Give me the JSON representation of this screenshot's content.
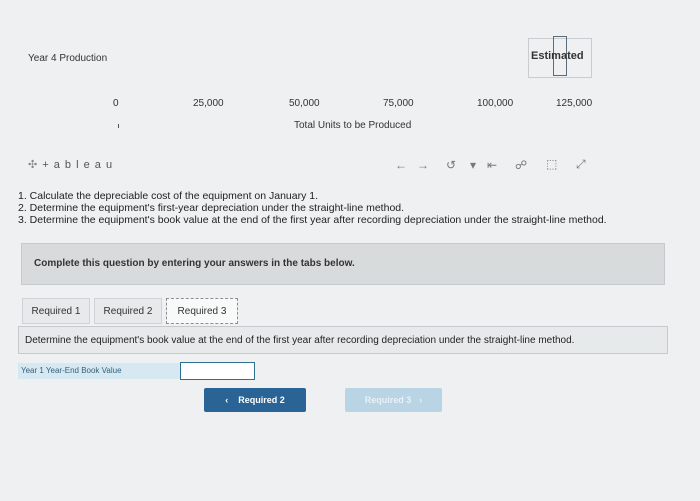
{
  "chart": {
    "title": "Year 4 Production",
    "legend_label": "Estimated",
    "x_ticks": [
      "0",
      "25,000",
      "50,000",
      "75,000",
      "100,000",
      "125,000"
    ],
    "x_axis_title": "Total Units to be Produced"
  },
  "tableau": {
    "logo": "+ a b l e a u"
  },
  "questions": [
    "1. Calculate the depreciable cost of the equipment on January 1.",
    "2. Determine the equipment's first-year depreciation under the straight-line method.",
    "3. Determine the equipment's book value at the end of the first year after recording depreciation under the straight-line method."
  ],
  "instructions": "Complete this question by entering your answers in the tabs below.",
  "tabs": [
    {
      "label": "Required 1"
    },
    {
      "label": "Required 2"
    },
    {
      "label": "Required 3"
    }
  ],
  "prompt": "Determine the equipment's book value at the end of the first year after recording depreciation under the straight-line method.",
  "field": {
    "label": "Year 1 Year-End Book Value",
    "value": ""
  },
  "nav": {
    "prev_label": "Required 2",
    "next_label": "Required 3"
  },
  "colors": {
    "primary_button": "#2a6496",
    "disabled_button": "#b9d4e4"
  }
}
